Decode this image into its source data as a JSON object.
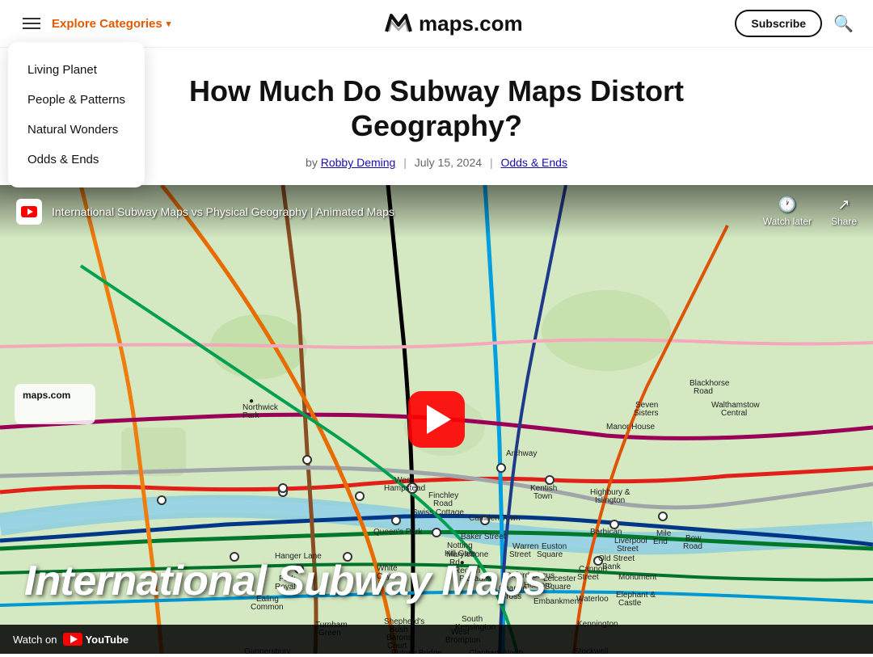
{
  "header": {
    "logo_text": "maps.com",
    "explore_label": "Explore Categories",
    "subscribe_label": "Subscribe"
  },
  "dropdown": {
    "items": [
      {
        "label": "Living Planet",
        "href": "#"
      },
      {
        "label": "People & Patterns",
        "href": "#"
      },
      {
        "label": "Natural Wonders",
        "href": "#"
      },
      {
        "label": "Odds & Ends",
        "href": "#"
      }
    ]
  },
  "article": {
    "title": "How Much Do Subway Maps Distort Geography?",
    "author": "Robby Deming",
    "date": "July 15, 2024",
    "category": "Odds & Ends"
  },
  "video": {
    "title": "International Subway Maps vs Physical Geography | Animated Maps",
    "bottom_title": "International Subway Maps",
    "watch_label": "Watch on",
    "yt_label": "YouTube",
    "watch_later": "Watch later",
    "share": "Share"
  }
}
